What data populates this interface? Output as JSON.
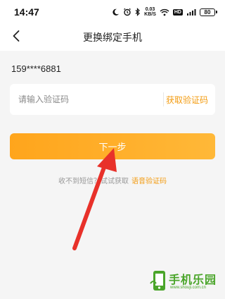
{
  "status_bar": {
    "time": "14:47",
    "net_speed_value": "0.03",
    "net_speed_unit": "KB/S",
    "hd_label": "HD",
    "battery": "80"
  },
  "header": {
    "title": "更换绑定手机",
    "back_icon": "chevron-left-icon"
  },
  "phone": {
    "masked_number": "159****6881"
  },
  "verification": {
    "placeholder": "请输入验证码",
    "value": "",
    "get_code_label": "获取验证码"
  },
  "actions": {
    "next_label": "下一步"
  },
  "help": {
    "text": "收不到短信？试试获取",
    "voice_code_label": "语音验证码"
  },
  "annotation": {
    "arrow_color": "#e8312a",
    "arrow_icon": "red-arrow-icon"
  },
  "watermark": {
    "text": "手机乐园",
    "url": "www.shouji.com.cn"
  },
  "colors": {
    "accent": "#f39c12",
    "button_start": "#ffa51c",
    "button_end": "#ffb838"
  }
}
